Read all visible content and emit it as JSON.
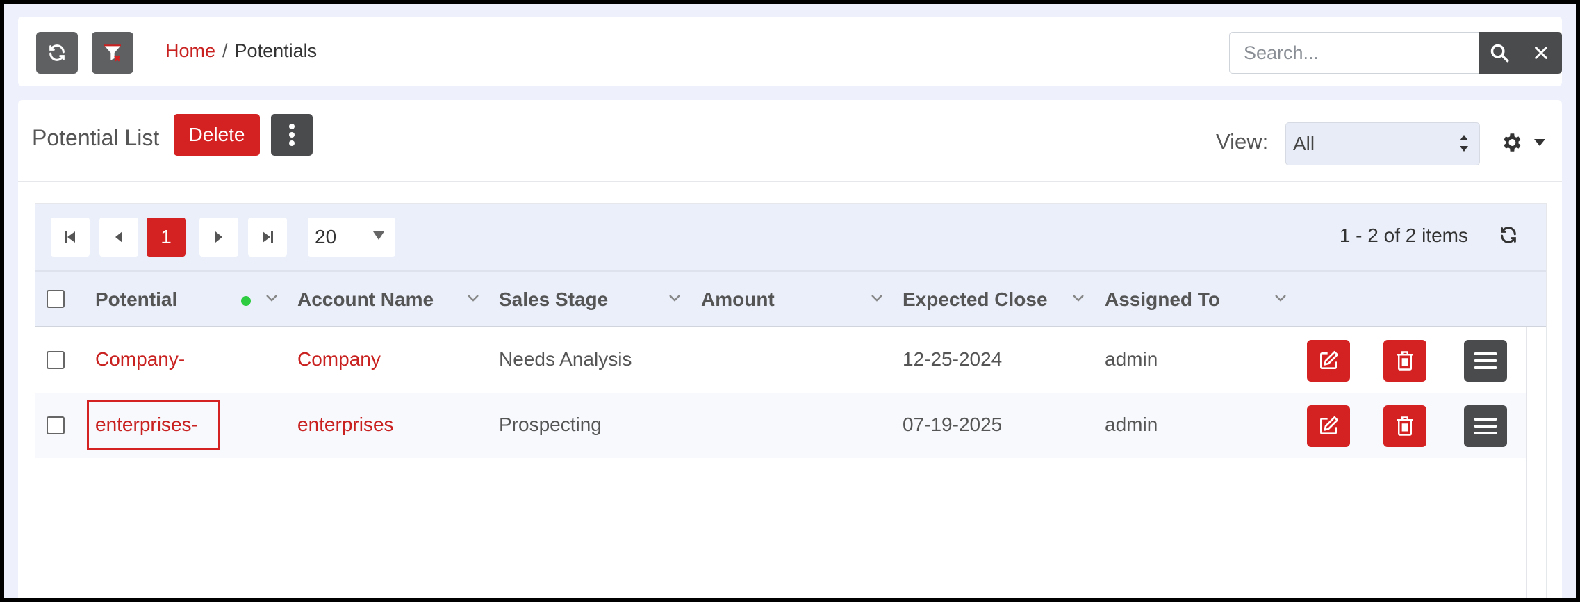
{
  "topbar": {
    "breadcrumb_home": "Home",
    "breadcrumb_sep": "/",
    "breadcrumb_current": "Potentials",
    "search_placeholder": "Search...",
    "icons": [
      "refresh-icon",
      "filter-clear-icon",
      "search-icon",
      "close-icon"
    ]
  },
  "header": {
    "title": "Potential List",
    "delete_label": "Delete",
    "view_label": "View:",
    "view_value": "All"
  },
  "pager": {
    "current_page": "1",
    "page_size": "20",
    "info": "1 - 2 of 2 items"
  },
  "columns": [
    {
      "label": "Potential"
    },
    {
      "label": "Account Name"
    },
    {
      "label": "Sales Stage"
    },
    {
      "label": "Amount"
    },
    {
      "label": "Expected Close"
    },
    {
      "label": "Assigned To"
    }
  ],
  "rows": [
    {
      "potential": "Company-",
      "account": "Company",
      "stage": "Needs Analysis",
      "amount": "",
      "close": "12-25-2024",
      "assigned": "admin"
    },
    {
      "potential": "enterprises-",
      "account": "enterprises",
      "stage": "Prospecting",
      "amount": "",
      "close": "07-19-2025",
      "assigned": "admin"
    }
  ],
  "colors": {
    "accent": "#d42222",
    "link": "#c8211f",
    "dark_button": "#4a4b4d",
    "status_dot": "#2ecc40"
  }
}
